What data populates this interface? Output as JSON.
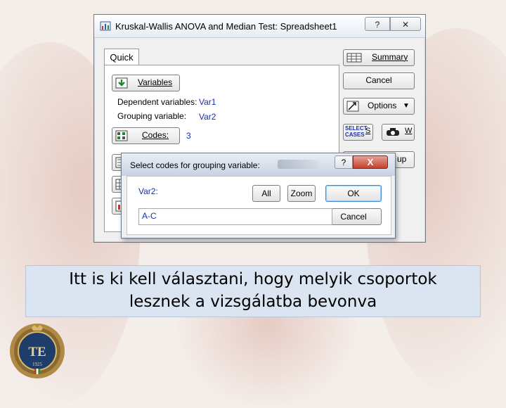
{
  "dialog": {
    "title": "Kruskal-Wallis ANOVA and Median Test: Spreadsheet1",
    "help_glyph": "?",
    "close_glyph": "✕",
    "tab_quick": "Quick",
    "variables_label": "Variables",
    "dependent_label": "Dependent variables:",
    "dependent_value": "Var1",
    "grouping_label": "Grouping variable:",
    "grouping_value": "Var2",
    "codes_label": "Codes:",
    "codes_value": "3",
    "summary_label": "Summary",
    "cancel_label": "Cancel",
    "options_label": "Options",
    "select_cases_label": "SELECT CASES",
    "s_label": "S",
    "w_label": "W",
    "partial_label": "up"
  },
  "subdialog": {
    "title": "Select codes for grouping variable:",
    "help_glyph": "?",
    "close_glyph": "X",
    "var_label": "Var2:",
    "input_value": "A-C",
    "all_label": "All",
    "zoom_label": "Zoom",
    "ok_label": "OK",
    "cancel_label": "Cancel"
  },
  "caption": {
    "line1": "Itt is ki kell választani, hogy melyik csoportok",
    "line2": "lesznek a vizsgálatba bevonva"
  },
  "logo": {
    "initials": "TE",
    "year": "1925"
  }
}
